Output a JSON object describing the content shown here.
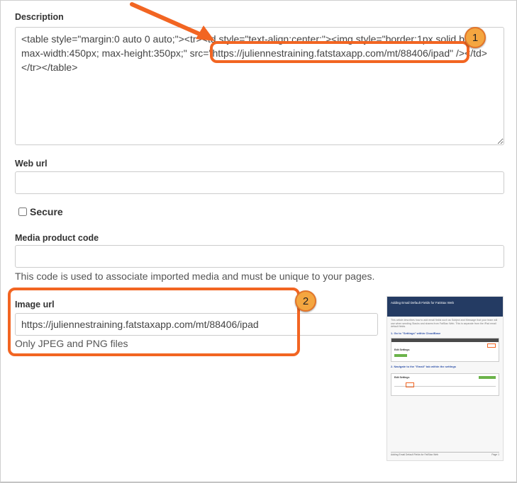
{
  "description": {
    "label": "Description",
    "value": "<table style=\"margin:0 auto 0 auto;\"><tr><td style=\"text-align:center;\"><img style=\"border:1px solid black; max-width:450px; max-height:350px;\" src=\"https://juliennestraining.fatstaxapp.com/mt/88406/ipad\" /></td></tr></table>"
  },
  "web_url": {
    "label": "Web url",
    "value": ""
  },
  "secure": {
    "label": "Secure",
    "checked": false
  },
  "media_product_code": {
    "label": "Media product code",
    "value": "",
    "help": "This code is used to associate imported media and must be unique to your pages."
  },
  "image_url": {
    "label": "Image url",
    "value": "https://juliennestraining.fatstaxapp.com/mt/88406/ipad",
    "help": "Only JPEG and PNG files"
  },
  "callouts": {
    "one": "1",
    "two": "2"
  },
  "colors": {
    "callout": "#f26522",
    "badge": "#f4a640",
    "thumb_header": "#243b63"
  },
  "thumbnail": {
    "title": "Adding Email Default Fields for FatStax Web",
    "intro": "This article describes how to add email fields such as Subject and Message that your team will use when sending Stacks and shares from FatStax Web. This is separate from the iPad email default fields.",
    "step1": "1. Go to \"Settings\" within CloudBase",
    "step2": "2. Navigate to the \"Email\" tab within the settings",
    "edit_settings": "Edit Settings",
    "footer_left": "Adding Email Default Fields for FatStax Web",
    "footer_right": "Page 1"
  }
}
